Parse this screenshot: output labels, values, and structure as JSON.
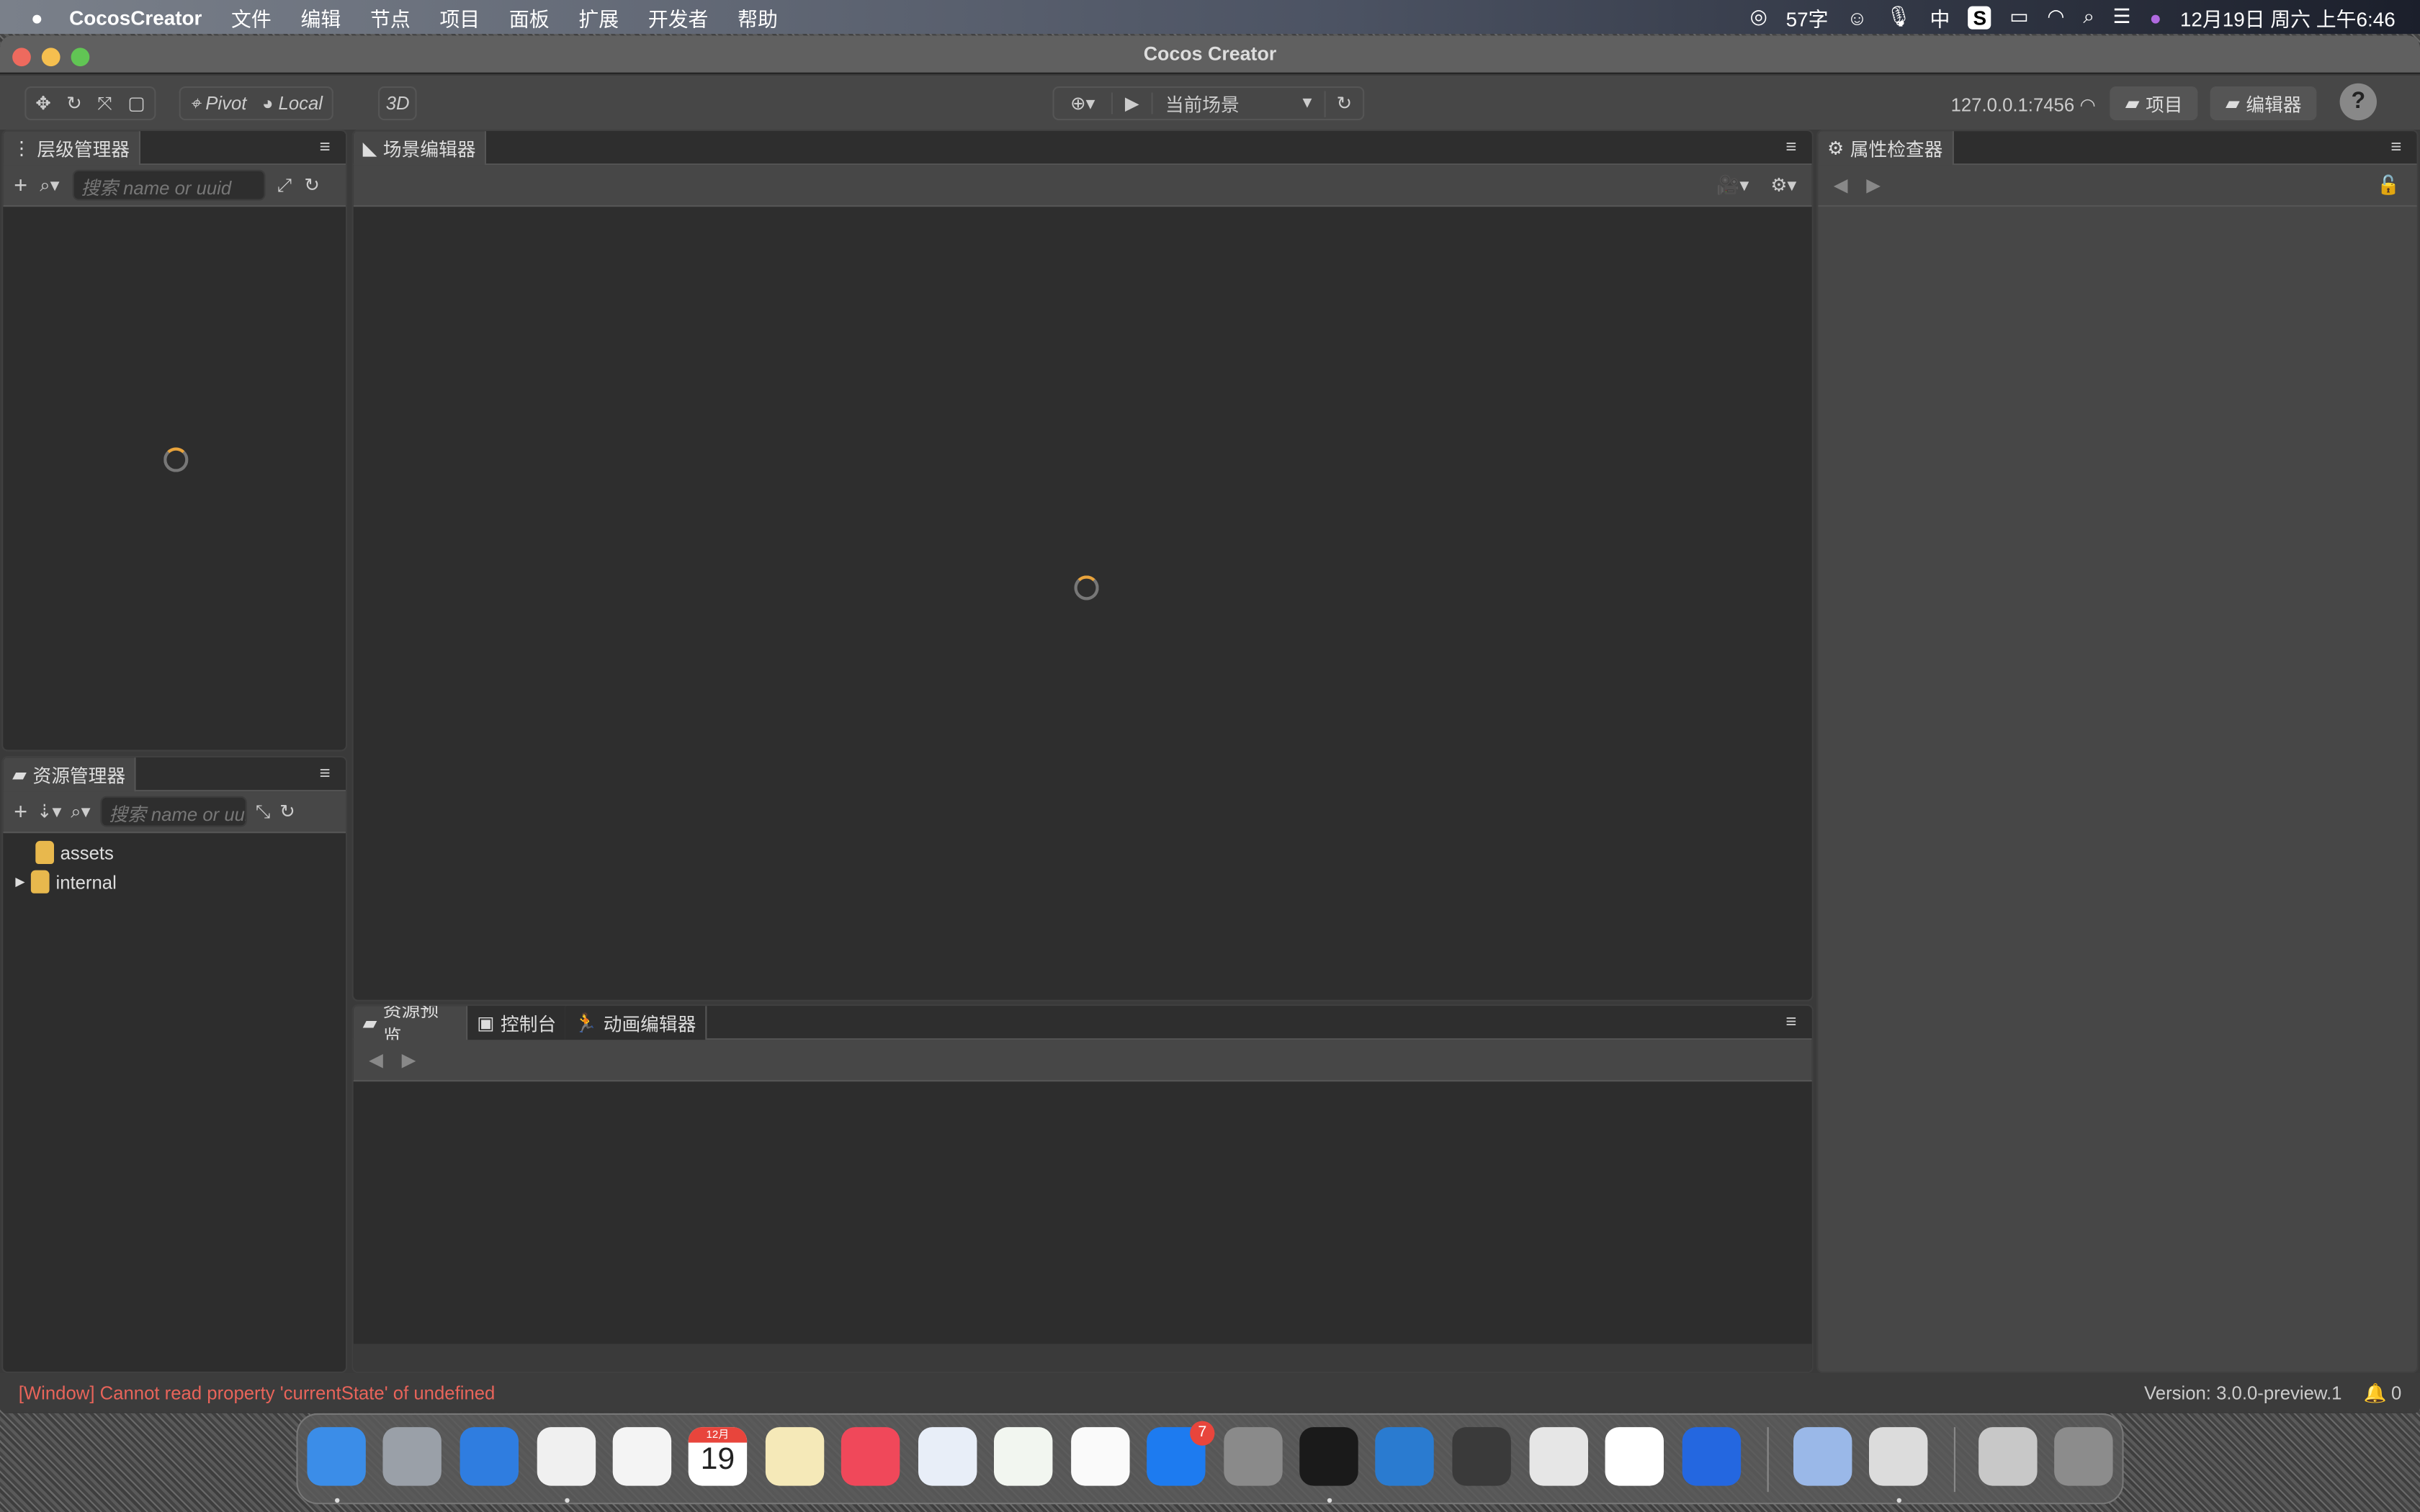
{
  "menubar": {
    "app": "CocosCreator",
    "items": [
      "文件",
      "编辑",
      "节点",
      "项目",
      "面板",
      "扩展",
      "开发者",
      "帮助"
    ],
    "word_count": "57字",
    "input_method": "中",
    "clock": "12月19日 周六 上午6:46"
  },
  "window": {
    "title": "Cocos Creator"
  },
  "toolbar": {
    "pivot": "Pivot",
    "local": "Local",
    "mode3d": "3D",
    "scene_select": "当前场景",
    "server": "127.0.0.1:7456",
    "project_btn": "项目",
    "editor_btn": "编辑器",
    "help": "?"
  },
  "hierarchy": {
    "title": "层级管理器",
    "search_placeholder": "搜索 name or uuid"
  },
  "assets": {
    "title": "资源管理器",
    "search_placeholder": "搜索 name or uuid",
    "items": [
      {
        "label": "assets",
        "expandable": false
      },
      {
        "label": "internal",
        "expandable": true
      }
    ]
  },
  "scene": {
    "title": "场景编辑器"
  },
  "inspector": {
    "title": "属性检查器"
  },
  "bottom": {
    "tabs": [
      "资源预览",
      "控制台",
      "动画编辑器"
    ]
  },
  "status": {
    "error": "[Window] Cannot read property 'currentState' of undefined",
    "version": "Version: 3.0.0-preview.1",
    "notifications": "0",
    "error_color": "#e8645a"
  },
  "dock": {
    "calendar_month": "12月",
    "calendar_day": "19",
    "appstore_badge": "7",
    "apps": [
      {
        "name": "finder",
        "color": "#3b8de8"
      },
      {
        "name": "launchpad",
        "color": "#9aa0a8"
      },
      {
        "name": "safari",
        "color": "#2f7de0"
      },
      {
        "name": "chrome",
        "color": "#f0f0f0"
      },
      {
        "name": "photos",
        "color": "#f4f4f4"
      },
      {
        "name": "calendar",
        "color": "#ffffff"
      },
      {
        "name": "notes",
        "color": "#f5e9b8"
      },
      {
        "name": "music",
        "color": "#f0485a"
      },
      {
        "name": "keynote",
        "color": "#e8eef8"
      },
      {
        "name": "numbers",
        "color": "#f2f6f0"
      },
      {
        "name": "pages",
        "color": "#fafafa"
      },
      {
        "name": "app-store",
        "color": "#1d7bf0"
      },
      {
        "name": "system-preferences",
        "color": "#8a8a8a"
      },
      {
        "name": "terminal",
        "color": "#1a1a1a"
      },
      {
        "name": "vscode",
        "color": "#2a7bd0"
      },
      {
        "name": "dashboard-drop",
        "color": "#3a3a3a"
      },
      {
        "name": "app-box",
        "color": "#e6e6e6"
      },
      {
        "name": "x-app",
        "color": "#ffffff"
      },
      {
        "name": "proxy-app",
        "color": "#2467e0"
      },
      {
        "name": "preview",
        "color": "#9ab8e8"
      },
      {
        "name": "drop-app",
        "color": "#dcdcdc"
      },
      {
        "name": "photo-stack",
        "color": "#c8c8c8"
      },
      {
        "name": "trash",
        "color": "#8c8c8c"
      }
    ]
  }
}
